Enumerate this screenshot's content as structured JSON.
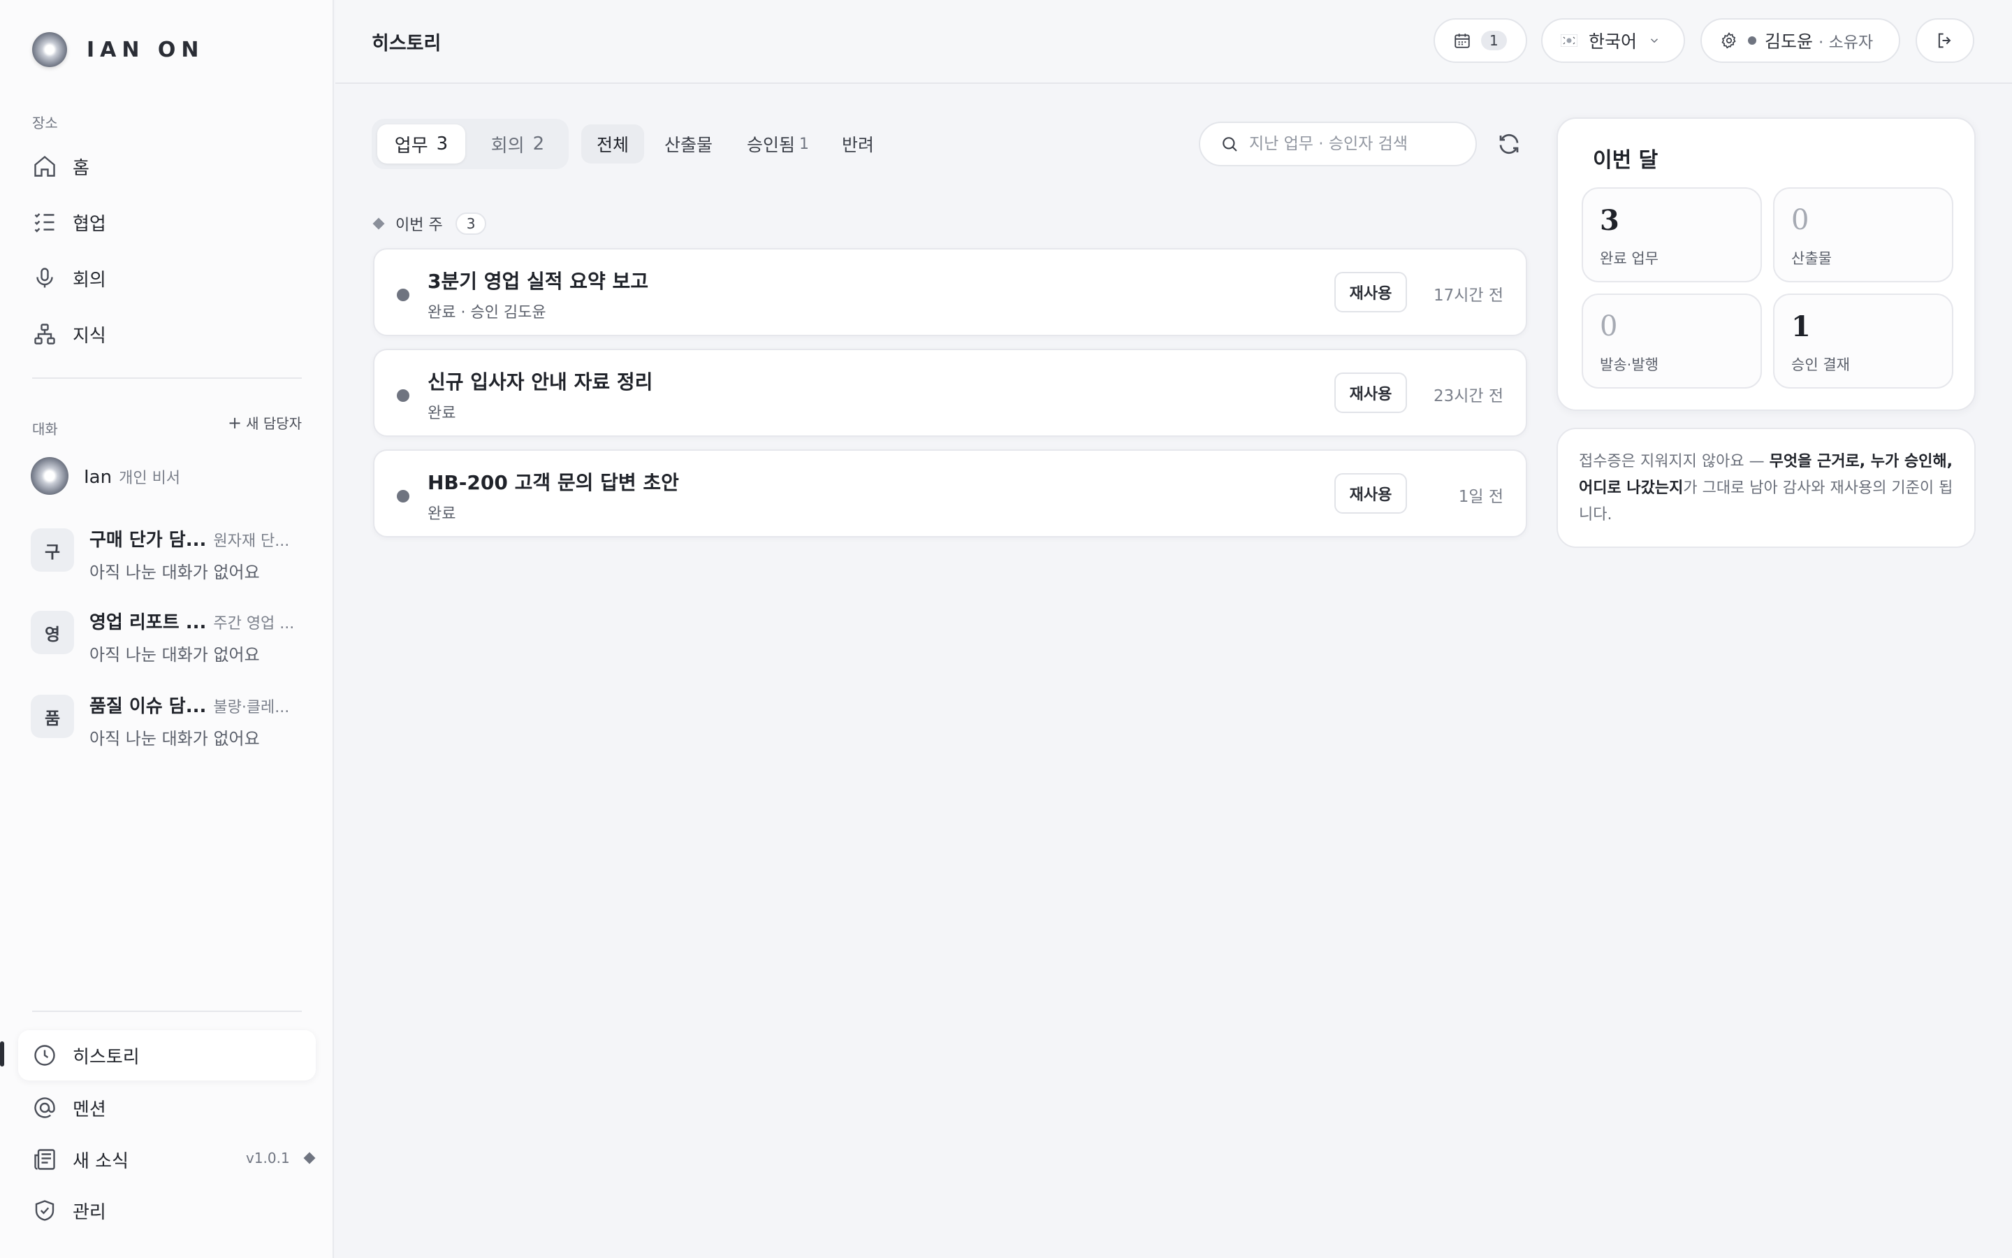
{
  "app": {
    "logo_text": "IAN ON"
  },
  "sidebar": {
    "places_label": "장소",
    "nav": [
      {
        "label": "홈",
        "icon": "home-icon"
      },
      {
        "label": "협업",
        "icon": "checklist-icon"
      },
      {
        "label": "회의",
        "icon": "microphone-icon"
      },
      {
        "label": "지식",
        "icon": "hierarchy-icon"
      }
    ],
    "chats_label": "대화",
    "new_agent_label": "새 담당자",
    "chats": [
      {
        "avatar": "",
        "name": "Ian",
        "sub": "개인 비서",
        "preview": ""
      },
      {
        "avatar": "구",
        "name": "구매 단가 담...",
        "sub": "원자재 단...",
        "preview": "아직 나눈 대화가 없어요"
      },
      {
        "avatar": "영",
        "name": "영업 리포트 ...",
        "sub": "주간 영업 ...",
        "preview": "아직 나눈 대화가 없어요"
      },
      {
        "avatar": "품",
        "name": "품질 이슈 담...",
        "sub": "불량·클레...",
        "preview": "아직 나눈 대화가 없어요"
      }
    ],
    "bottom": [
      {
        "label": "히스토리",
        "icon": "clock-icon",
        "active": true
      },
      {
        "label": "멘션",
        "icon": "at-icon"
      },
      {
        "label": "새 소식",
        "icon": "news-icon"
      },
      {
        "label": "관리",
        "icon": "shield-check-icon"
      }
    ],
    "version": "v1.0.1"
  },
  "header": {
    "title": "히스토리",
    "calendar_count": "1",
    "language": "한국어",
    "user_name": "김도윤",
    "user_role": "· 소유자"
  },
  "tabs": [
    {
      "label": "업무",
      "count": "3",
      "active": true
    },
    {
      "label": "회의",
      "count": "2",
      "active": false
    }
  ],
  "filters": [
    {
      "label": "전체",
      "count": "",
      "active": true
    },
    {
      "label": "산출물",
      "count": ""
    },
    {
      "label": "승인됨",
      "count": "1"
    },
    {
      "label": "반려",
      "count": ""
    }
  ],
  "search": {
    "placeholder": "지난 업무 · 승인자 검색"
  },
  "group": {
    "label": "이번 주",
    "count": "3"
  },
  "rows": [
    {
      "title": "3분기 영업 실적 요약 보고",
      "sub": "완료 · 승인 김도윤",
      "action": "재사용",
      "time": "17시간 전"
    },
    {
      "title": "신규 입사자 안내 자료 정리",
      "sub": "완료",
      "action": "재사용",
      "time": "23시간 전"
    },
    {
      "title": "HB-200 고객 문의 답변 초안",
      "sub": "완료",
      "action": "재사용",
      "time": "1일 전"
    }
  ],
  "month": {
    "title": "이번 달",
    "stats": [
      {
        "value": "3",
        "label": "완료 업무"
      },
      {
        "value": "0",
        "label": "산출물"
      },
      {
        "value": "0",
        "label": "발송·발행"
      },
      {
        "value": "1",
        "label": "승인 결재"
      }
    ]
  },
  "note": {
    "part1": "접수증은 지워지지 않아요 — ",
    "bold": "무엇을 근거로, 누가 승인해, 어디로 나갔는지",
    "part2": "가 그대로 남아 감사와 재사용의 기준이 됩니다."
  }
}
